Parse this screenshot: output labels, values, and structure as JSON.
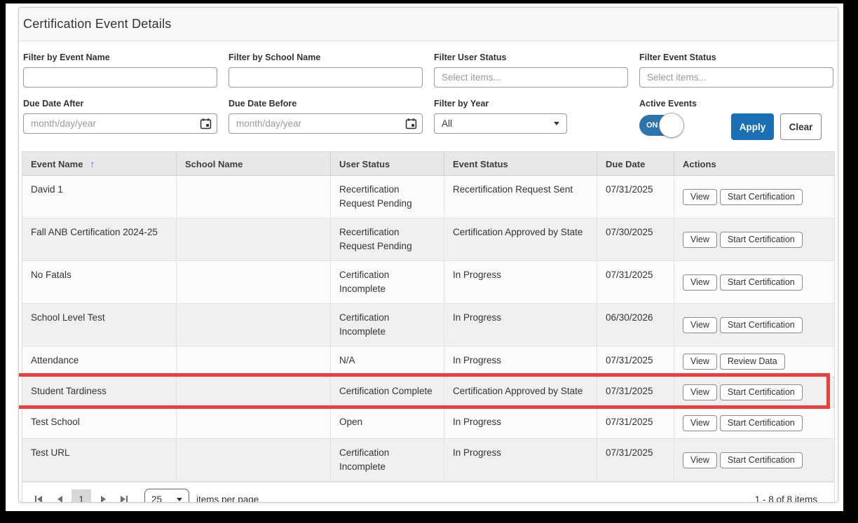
{
  "page": {
    "title": "Certification Event Details"
  },
  "colors": {
    "accent_blue": "#1b70b5",
    "toggle_blue": "#2d74ad",
    "highlight_red": "#e8403a",
    "sort_arrow_blue": "#2a79c1"
  },
  "filters": {
    "event_name": {
      "label": "Filter by Event Name",
      "value": ""
    },
    "school_name": {
      "label": "Filter by School Name",
      "value": ""
    },
    "user_status": {
      "label": "Filter User Status",
      "placeholder": "Select items..."
    },
    "event_status": {
      "label": "Filter Event Status",
      "placeholder": "Select items..."
    },
    "due_date_after": {
      "label": "Due Date After",
      "placeholder": "month/day/year",
      "value": ""
    },
    "due_date_before": {
      "label": "Due Date Before",
      "placeholder": "month/day/year",
      "value": ""
    },
    "year": {
      "label": "Filter by Year",
      "value": "All"
    },
    "active_events": {
      "label": "Active Events",
      "state": "ON"
    },
    "apply_label": "Apply",
    "clear_label": "Clear"
  },
  "table": {
    "columns": [
      "Event Name",
      "School Name",
      "User Status",
      "Event Status",
      "Due Date",
      "Actions"
    ],
    "sort_indicator": "↑",
    "rows": [
      {
        "event_name": "David 1",
        "school_name": "",
        "user_status": "Recertification Request Pending",
        "event_status": "Recertification Request Sent",
        "due_date": "07/31/2025",
        "actions": [
          "View",
          "Start Certification"
        ],
        "highlighted": false
      },
      {
        "event_name": "Fall ANB Certification 2024-25",
        "school_name": "",
        "user_status": "Recertification Request Pending",
        "event_status": "Certification Approved by State",
        "due_date": "07/30/2025",
        "actions": [
          "View",
          "Start Certification"
        ],
        "highlighted": false
      },
      {
        "event_name": "No Fatals",
        "school_name": "",
        "user_status": "Certification Incomplete",
        "event_status": "In Progress",
        "due_date": "07/31/2025",
        "actions": [
          "View",
          "Start Certification"
        ],
        "highlighted": false
      },
      {
        "event_name": "School Level Test",
        "school_name": "",
        "user_status": "Certification Incomplete",
        "event_status": "In Progress",
        "due_date": "06/30/2026",
        "actions": [
          "View",
          "Start Certification"
        ],
        "highlighted": false
      },
      {
        "event_name": "Attendance",
        "school_name": "",
        "user_status": "N/A",
        "event_status": "In Progress",
        "due_date": "07/31/2025",
        "actions": [
          "View",
          "Review Data"
        ],
        "highlighted": false
      },
      {
        "event_name": "Student Tardiness",
        "school_name": "",
        "user_status": "Certification Complete",
        "event_status": "Certification Approved by State",
        "due_date": "07/31/2025",
        "actions": [
          "View",
          "Start Certification"
        ],
        "highlighted": true
      },
      {
        "event_name": "Test School",
        "school_name": "",
        "user_status": "Open",
        "event_status": "In Progress",
        "due_date": "07/31/2025",
        "actions": [
          "View",
          "Start Certification"
        ],
        "highlighted": false
      },
      {
        "event_name": "Test URL",
        "school_name": "",
        "user_status": "Certification Incomplete",
        "event_status": "In Progress",
        "due_date": "07/31/2025",
        "actions": [
          "View",
          "Start Certification"
        ],
        "highlighted": false
      }
    ]
  },
  "pager": {
    "current_page": "1",
    "page_size": "25",
    "items_per_page_label": "items per page",
    "range_label": "1 - 8 of 8 items"
  }
}
